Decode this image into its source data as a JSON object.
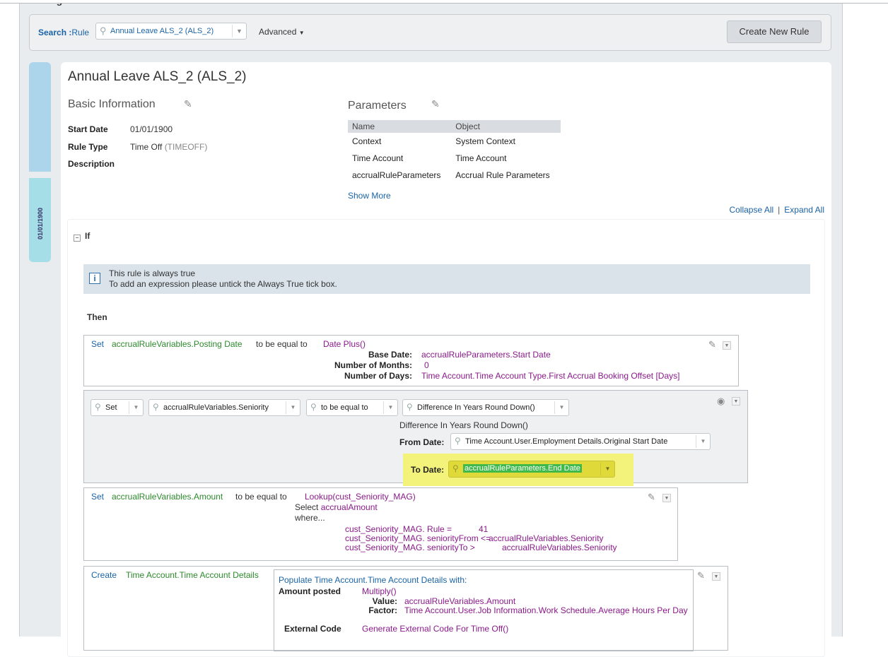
{
  "page": {
    "heading": "Configure Business Rules"
  },
  "search": {
    "label": "Search :",
    "label_suffix": "Rule",
    "value": "Annual Leave ALS_2 (ALS_2)",
    "advanced": "Advanced",
    "create_button": "Create New Rule"
  },
  "sidebar": {
    "date": "01/01/1900"
  },
  "rule": {
    "title": "Annual Leave ALS_2 (ALS_2)",
    "basic_info_title": "Basic Information",
    "start_date_label": "Start Date",
    "start_date": "01/01/1900",
    "rule_type_label": "Rule Type",
    "rule_type": "Time Off",
    "rule_type_code": "(TIMEOFF)",
    "description_label": "Description"
  },
  "parameters": {
    "title": "Parameters",
    "headers": [
      "Name",
      "Object"
    ],
    "rows": [
      [
        "Context",
        "System Context"
      ],
      [
        "Time Account",
        "Time Account"
      ],
      [
        "accrualRuleParameters",
        "Accrual Rule Parameters"
      ]
    ],
    "show_more": "Show More"
  },
  "links": {
    "collapse_all": "Collapse All",
    "expand_all": "Expand All"
  },
  "if_block": {
    "label": "If",
    "info_line1": "This rule is always true",
    "info_line2": "To add an expression please untick the Always True tick box.",
    "then_label": "Then"
  },
  "stmt1": {
    "set": "Set",
    "target": "accrualRuleVariables.Posting Date",
    "op": "to be equal to",
    "func": "Date Plus()",
    "base_date_label": "Base Date:",
    "base_date": "accrualRuleParameters.Start Date",
    "months_label": "Number of Months:",
    "months": "0",
    "days_label": "Number of Days:",
    "days": "Time Account.Time Account Type.First Accrual Booking Offset [Days]"
  },
  "stmt2": {
    "set": "Set",
    "target": "accrualRuleVariables.Seniority",
    "op": "to be equal to",
    "func": "Difference In Years Round Down()",
    "func_title": "Difference In Years Round Down()",
    "from_label": "From Date:",
    "from_value": "Time Account.User.Employment Details.Original Start Date",
    "to_label": "To Date:",
    "to_value": "accrualRuleParameters.End Date"
  },
  "stmt3": {
    "set": "Set",
    "target": "accrualRuleVariables.Amount",
    "op": "to be equal to",
    "func": "Lookup(cust_Seniority_MAG)",
    "select_label": "Select",
    "select_value": "accrualAmount",
    "where": "where...",
    "cond1": "cust_Seniority_MAG. Rule =",
    "cond1_val": "41",
    "cond2": "cust_Seniority_MAG. seniorityFrom <=",
    "cond2_val": "accrualRuleVariables.Seniority",
    "cond3": "cust_Seniority_MAG. seniorityTo >",
    "cond3_val": "accrualRuleVariables.Seniority"
  },
  "stmt4": {
    "create": "Create",
    "target": "Time Account.Time Account Details",
    "populate": "Populate Time Account.Time Account Details with:",
    "amount_label": "Amount posted",
    "amount_func": "Multiply()",
    "value_label": "Value:",
    "value": "accrualRuleVariables.Amount",
    "factor_label": "Factor:",
    "factor": "Time Account.User.Job Information.Work Schedule.Average Hours Per Day",
    "ext_label": "External Code",
    "ext_value": "Generate External Code For Time Off()"
  },
  "colors": {
    "link": "#1a63a6",
    "green": "#2c8a2c",
    "purple": "#8a1a8a",
    "highlight": "#f3f27a",
    "selection": "#3fb94a"
  }
}
